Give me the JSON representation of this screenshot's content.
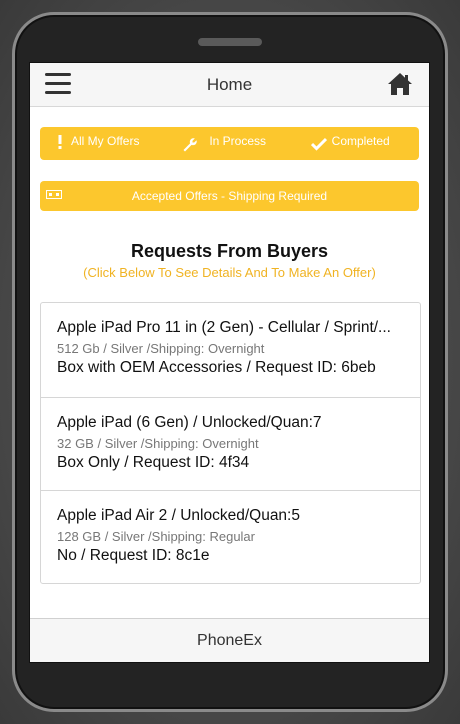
{
  "header": {
    "title": "Home"
  },
  "tabs": [
    {
      "label": "All My Offers",
      "icon": "exclamation-icon"
    },
    {
      "label": "In Process",
      "icon": "wrench-icon"
    },
    {
      "label": "Completed",
      "icon": "check-icon"
    }
  ],
  "banner": {
    "label": "Accepted Offers - Shipping Required",
    "icon": "shipping-icon"
  },
  "section": {
    "title": "Requests From Buyers",
    "subtitle": "(Click Below To See Details And To Make An Offer)"
  },
  "requests": [
    {
      "title": "Apple iPad Pro 11 in (2 Gen) - Cellular / Sprint/...",
      "subtitle": "512 Gb / Silver /Shipping: Overnight",
      "detail": "Box with OEM Accessories / Request ID: 6beb"
    },
    {
      "title": "Apple iPad (6 Gen) / Unlocked/Quan:7",
      "subtitle": "32 GB / Silver /Shipping: Overnight",
      "detail": "Box Only / Request ID: 4f34"
    },
    {
      "title": "Apple iPad Air 2 / Unlocked/Quan:5",
      "subtitle": "128 GB / Silver /Shipping: Regular",
      "detail": "No / Request ID: 8c1e"
    }
  ],
  "footer": {
    "title": "PhoneEx"
  },
  "colors": {
    "accent": "#fcc72d",
    "subtitle": "#f0b323",
    "frame": "#232323"
  }
}
